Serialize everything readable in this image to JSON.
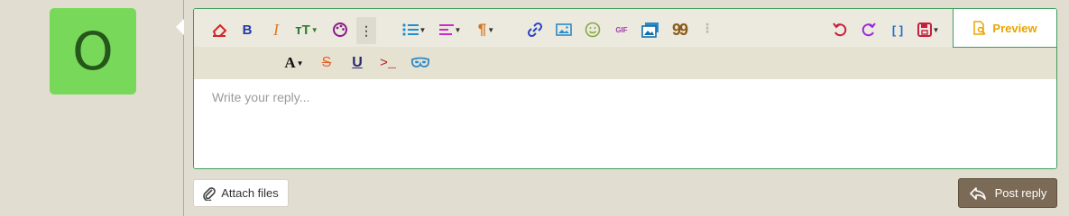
{
  "avatar": {
    "letter": "O",
    "color": "#78d85a"
  },
  "toolbar": {
    "bold": "B",
    "italic": "I",
    "font_size": "тT",
    "font_color": "A",
    "strike": "S",
    "underline": "U",
    "code_inline": ">_",
    "gif": "GIF",
    "quote": "99",
    "bbcode": "[ ]",
    "preview_label": "Preview"
  },
  "editor": {
    "placeholder": "Write your reply..."
  },
  "footer": {
    "attach_label": "Attach files",
    "post_label": "Post reply"
  },
  "colors": {
    "accent_green": "#3f9e5a",
    "preview_yellow": "#e7a500",
    "post_brown": "#7b6a55"
  }
}
